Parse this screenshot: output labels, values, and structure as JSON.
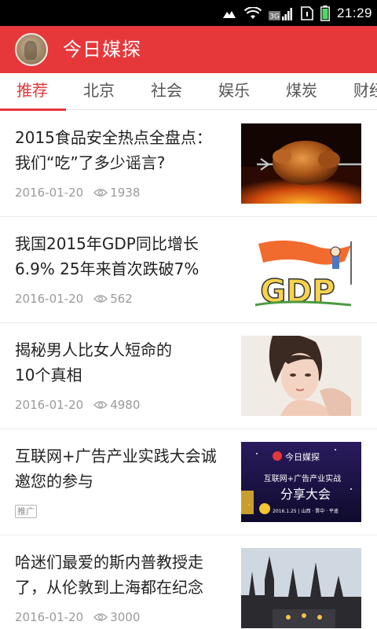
{
  "status_bar": {
    "network": "3G",
    "time": "21:29"
  },
  "header": {
    "app_title": "今日媒探"
  },
  "tabs": [
    "推荐",
    "北京",
    "社会",
    "娱乐",
    "煤炭",
    "财经"
  ],
  "news": [
    {
      "title": "2015食品安全热点全盘点：我们“吃”了多少谣言?",
      "date": "2016-01-20",
      "views": "1938",
      "thumb": "roast-chicken-image"
    },
    {
      "title": "我国2015年GDP同比增长6.9% 25年来首次跌破7%",
      "date": "2016-01-20",
      "views": "562",
      "thumb": "gdp-cartoon-image",
      "thumb_text": "GDP"
    },
    {
      "title": "揭秘男人比女人短命的10个真相",
      "date": "2016-01-20",
      "views": "4980",
      "thumb": "portrait-image"
    },
    {
      "title": "互联网+广告产业实践大会诚邀您的参与",
      "badge": "推广",
      "thumb": "conference-banner-image",
      "banner": {
        "brand": "今日媒探",
        "line1": "互联网+广告产业实战",
        "line2": "分享大会",
        "footer": "2016.1.25 | 山西 · 晋中 · 平遥"
      }
    },
    {
      "title": "哈迷们最爱的斯内普教授走了，从伦敦到上海都在纪念",
      "date": "2016-01-20",
      "views": "3000",
      "thumb": "hogwarts-castle-image"
    }
  ],
  "colors": {
    "accent": "#e6373a",
    "meta": "#9a9a9a"
  }
}
